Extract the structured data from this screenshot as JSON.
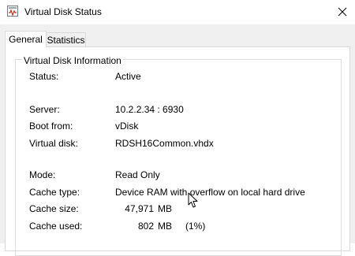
{
  "window": {
    "title": "Virtual Disk Status",
    "icon": "disk-status-icon"
  },
  "tabs": [
    {
      "label": "General",
      "selected": true
    },
    {
      "label": "Statistics",
      "selected": false
    }
  ],
  "group": {
    "title": "Virtual Disk Information"
  },
  "fields": {
    "status": {
      "label": "Status:",
      "value": "Active"
    },
    "server": {
      "label": "Server:",
      "value": "10.2.2.34 : 6930"
    },
    "boot_from": {
      "label": "Boot from:",
      "value": "vDisk"
    },
    "virtual_disk": {
      "label": "Virtual disk:",
      "value": "RDSH16Common.vhdx"
    },
    "mode": {
      "label": "Mode:",
      "value": "Read Only"
    },
    "cache_type": {
      "label": "Cache type:",
      "value": "Device RAM with overflow on local hard drive"
    },
    "cache_size": {
      "label": "Cache size:",
      "amount": "47,971",
      "unit": "MB"
    },
    "cache_used": {
      "label": "Cache used:",
      "amount": "802",
      "unit": "MB",
      "percent": "(1%)"
    }
  },
  "colors": {
    "window_bg": "#f0f0f0",
    "panel_bg": "#ffffff",
    "border": "#d9d9d9",
    "icon_accent": "#c0392b"
  }
}
